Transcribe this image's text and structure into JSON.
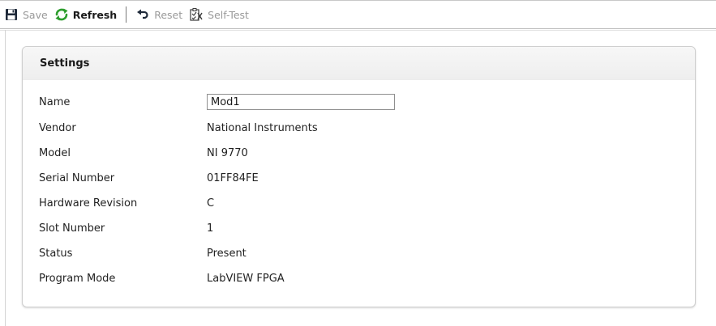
{
  "toolbar": {
    "save_label": "Save",
    "refresh_label": "Refresh",
    "reset_label": "Reset",
    "selftest_label": "Self-Test"
  },
  "panel": {
    "title": "Settings",
    "fields": {
      "name": {
        "label": "Name",
        "value": "Mod1"
      },
      "vendor": {
        "label": "Vendor",
        "value": "National Instruments"
      },
      "model": {
        "label": "Model",
        "value": "NI 9770"
      },
      "serial": {
        "label": "Serial Number",
        "value": "01FF84FE"
      },
      "hw_rev": {
        "label": "Hardware Revision",
        "value": "C"
      },
      "slot": {
        "label": "Slot Number",
        "value": "1"
      },
      "status": {
        "label": "Status",
        "value": "Present"
      },
      "program_mode": {
        "label": "Program Mode",
        "value": "LabVIEW FPGA"
      }
    }
  },
  "colors": {
    "refresh_icon": "#2e9e2e",
    "panel_border": "#cfcfcf"
  },
  "icons": [
    "save-icon",
    "refresh-icon",
    "reset-icon",
    "self-test-icon"
  ]
}
